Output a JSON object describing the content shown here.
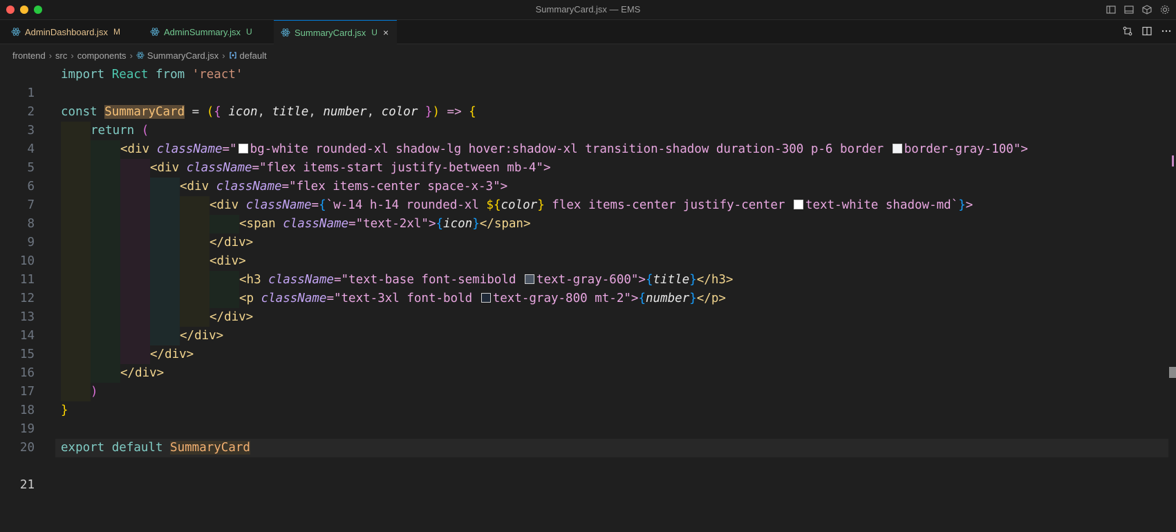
{
  "window": {
    "title": "SummaryCard.jsx — EMS"
  },
  "tabs": [
    {
      "name": "AdminDashboard.jsx",
      "status": "M"
    },
    {
      "name": "AdminSummary.jsx",
      "status": "U"
    },
    {
      "name": "SummaryCard.jsx",
      "status": "U",
      "close": "×"
    }
  ],
  "breadcrumb": [
    "frontend",
    "src",
    "components",
    "SummaryCard.jsx",
    "default"
  ],
  "breadcrumb_sep": "›",
  "lines": [
    "1",
    "2",
    "3",
    "4",
    "5",
    "6",
    "7",
    "8",
    "9",
    "10",
    "11",
    "12",
    "13",
    "14",
    "15",
    "16",
    "17",
    "18",
    "19",
    "20",
    "21"
  ],
  "code": {
    "l1": {
      "import": "import",
      "react": "React",
      "from": "from",
      "str": "'react'"
    },
    "l3": {
      "const": "const",
      "name": "SummaryCard",
      "eq": " = ",
      "p_open": "(",
      "b_open": "{",
      "icon": " icon",
      "c1": ",",
      "title": " title",
      "c2": ",",
      "number": " number",
      "c3": ",",
      "color": " color ",
      "b_close": "}",
      "p_close": ")",
      "arrow": " => ",
      "b2_open": "{"
    },
    "l4": {
      "ret": "return",
      "paren": " ("
    },
    "l5": {
      "open": "<div",
      "attr": " className",
      "eq": "=\"",
      "v1": "bg-white rounded-xl shadow-lg hover:shadow-xl transition-shadow duration-300 p-6 border ",
      "v2": "border-gray-100",
      "close": "\">"
    },
    "l6": {
      "open": "<div",
      "attr": " className",
      "eq": "=\"",
      "v": "flex items-start justify-between mb-4",
      "close": "\">"
    },
    "l7": {
      "open": "<div",
      "attr": " className",
      "eq": "=\"",
      "v": "flex items-center space-x-3",
      "close": "\">"
    },
    "l8": {
      "open": "<div",
      "attr": " className",
      "eq": "=",
      "b": "{",
      "tick": "`",
      "v1": "w-14 h-14 rounded-xl ",
      "interp_open": "${",
      "color": "color",
      "interp_close": "}",
      "v2": " flex items-center justify-center ",
      "v3": "text-white shadow-md",
      "tick2": "`",
      "b2": "}",
      "close": ">"
    },
    "l9": {
      "open": "<span",
      "attr": " className",
      "eq": "=\"",
      "v": "text-2xl",
      "q": "\">",
      "b": "{",
      "icon": "icon",
      "b2": "}",
      "close": "</span>"
    },
    "l10": {
      "close": "</div>"
    },
    "l11": {
      "open": "<div>"
    },
    "l12": {
      "open": "<h3",
      "attr": " className",
      "eq": "=\"",
      "v1": "text-base font-semibold ",
      "v2": "text-gray-600",
      "q": "\">",
      "b": "{",
      "title": "title",
      "b2": "}",
      "close": "</h3>"
    },
    "l13": {
      "open": "<p",
      "attr": " className",
      "eq": "=\"",
      "v1": "text-3xl font-bold ",
      "v2": "text-gray-800 mt-2",
      "q": "\">",
      "b": "{",
      "number": "number",
      "b2": "}",
      "close": "</p>"
    },
    "l14": {
      "close": "</div>"
    },
    "l15": {
      "close": "</div>"
    },
    "l16": {
      "close": "</div>"
    },
    "l17": {
      "close": "</div>"
    },
    "l18": {
      "paren": ")"
    },
    "l19": {
      "brace": "}"
    },
    "l21": {
      "export": "export",
      "default": " default ",
      "name": "SummaryCard"
    }
  },
  "swatches": {
    "white": "#ffffff",
    "gray100": "#f3f4f6",
    "gray600": "#4b5563",
    "gray800": "#1f2937"
  },
  "icons": [
    "react-icon",
    "split-editor-icon",
    "compare-changes-icon",
    "more-actions-icon",
    "toggle-sidebar-icon",
    "toggle-panel-icon",
    "customize-layout-icon",
    "settings-icon",
    "symbol-icon"
  ]
}
